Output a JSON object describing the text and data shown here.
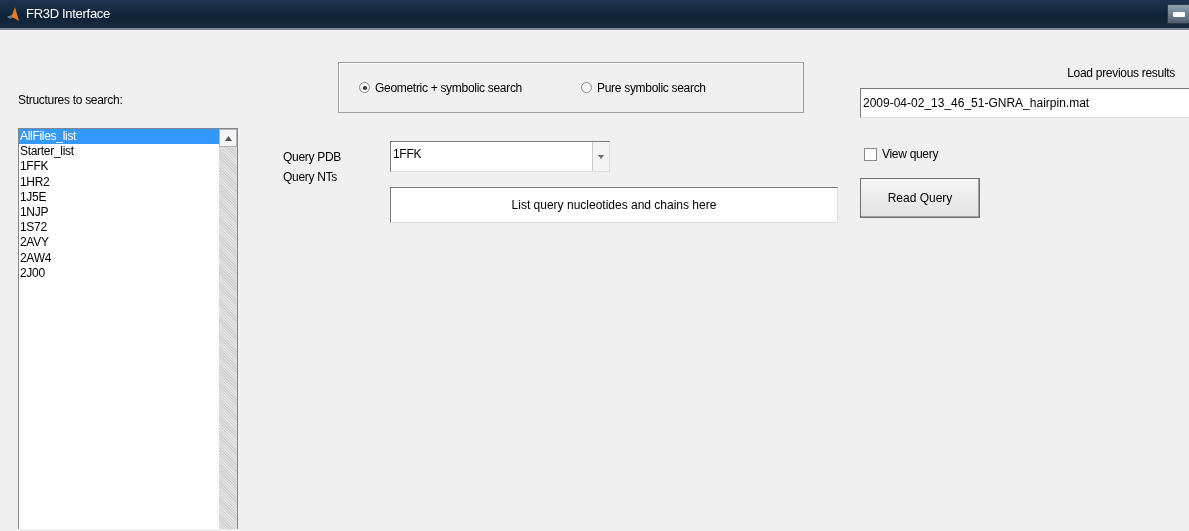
{
  "window": {
    "title": "FR3D Interface"
  },
  "structures": {
    "label": "Structures to search:",
    "items": [
      {
        "text": "AllFiles_list",
        "selected": true
      },
      {
        "text": "Starter_list",
        "selected": false
      },
      {
        "text": "1FFK",
        "selected": false
      },
      {
        "text": "1HR2",
        "selected": false
      },
      {
        "text": "1J5E",
        "selected": false
      },
      {
        "text": "1NJP",
        "selected": false
      },
      {
        "text": "1S72",
        "selected": false
      },
      {
        "text": "2AVY",
        "selected": false
      },
      {
        "text": "2AW4",
        "selected": false
      },
      {
        "text": "2J00",
        "selected": false
      }
    ]
  },
  "search_mode": [
    {
      "label": "Geometric + symbolic search",
      "selected": true
    },
    {
      "label": "Pure symbolic search",
      "selected": false
    }
  ],
  "query_pdb": {
    "label": "Query PDB",
    "value": "1FFK"
  },
  "query_nts": {
    "label": "Query NTs",
    "value": "List query nucleotides and chains here"
  },
  "load_previous": {
    "label": "Load previous results",
    "value": "2009-04-02_13_46_51-GNRA_hairpin.mat"
  },
  "view_query": {
    "label": "View query",
    "checked": false
  },
  "read_query_button": "Read Query"
}
